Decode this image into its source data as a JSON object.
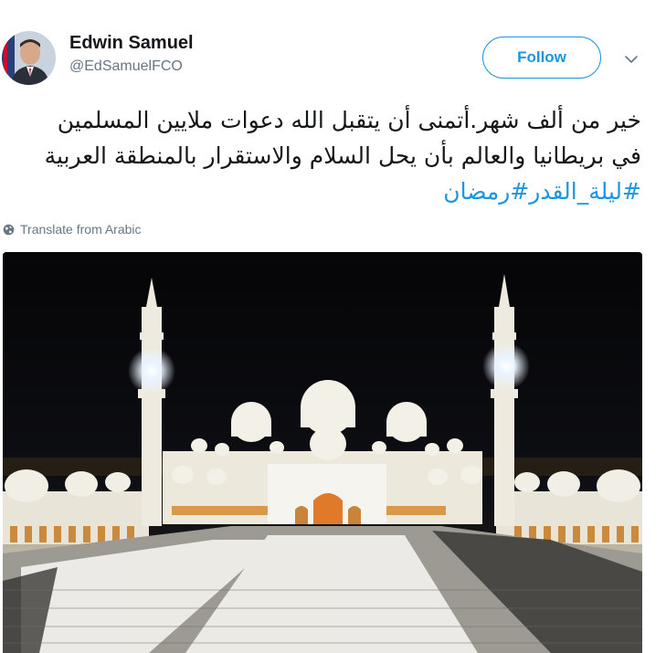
{
  "author": {
    "name": "Edwin Samuel",
    "handle": "@EdSamuelFCO"
  },
  "actions": {
    "follow_label": "Follow"
  },
  "tweet": {
    "lines": [
      "خير من ألف شهر.أتمنى أن يتقبل الله دعوات ملايين المسلمين",
      "في بريطانيا والعالم بأن يحل السلام والاستقرار بالمنطقة العربية"
    ],
    "hashtags": [
      "#ليلة_القدر",
      "#رمضان"
    ]
  },
  "translate_label": "Translate from Arabic",
  "icons": {
    "caret": "chevron-down-icon",
    "translate": "globe-icon"
  },
  "colors": {
    "link": "#1b95e0",
    "secondary_text": "#657786",
    "primary_text": "#14171a"
  }
}
